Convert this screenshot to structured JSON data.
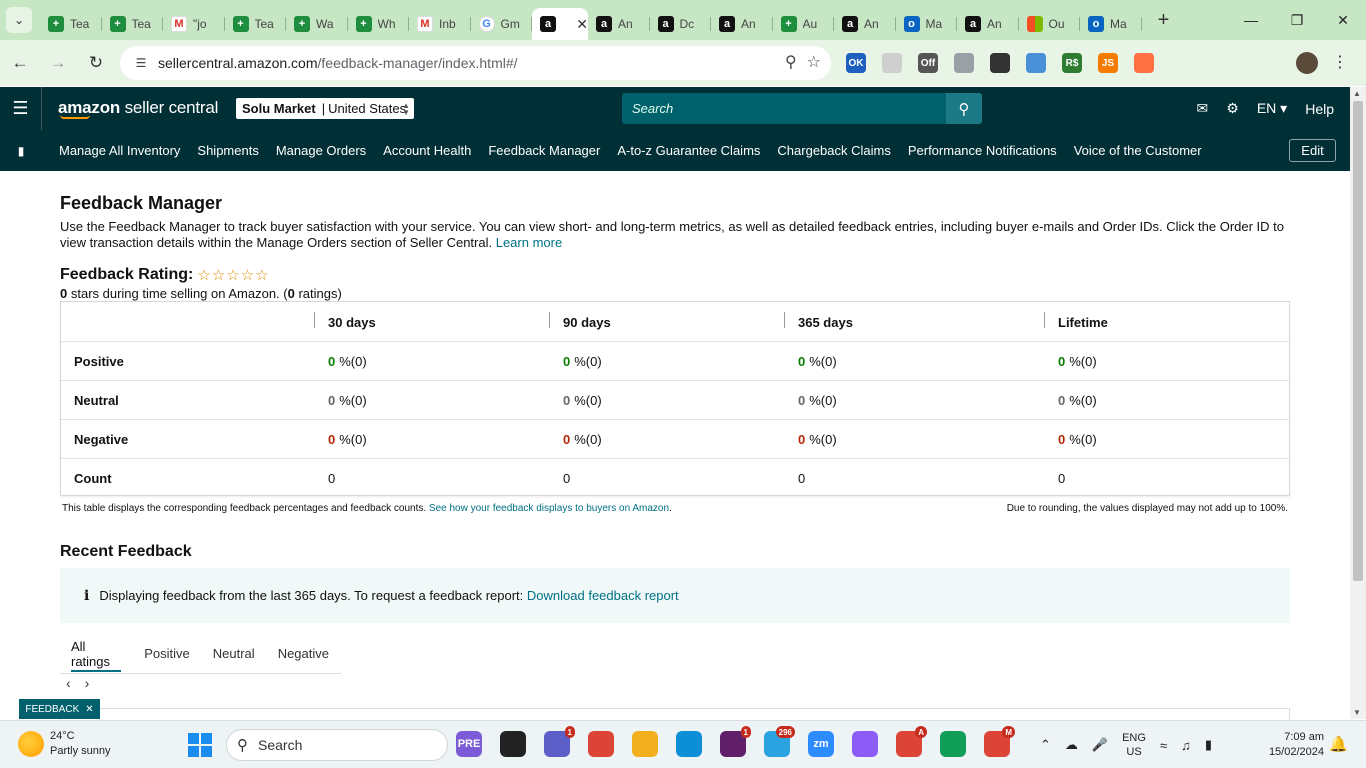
{
  "browser": {
    "tabs": [
      {
        "label": "Tea",
        "favicon": "sheets"
      },
      {
        "label": "Tea",
        "favicon": "sheets"
      },
      {
        "label": "\"jo",
        "favicon": "gmail"
      },
      {
        "label": "Tea",
        "favicon": "sheets"
      },
      {
        "label": "Wa",
        "favicon": "sheets"
      },
      {
        "label": "Wh",
        "favicon": "sheets"
      },
      {
        "label": "Inb",
        "favicon": "gmail"
      },
      {
        "label": "Gm",
        "favicon": "google"
      },
      {
        "label": "",
        "favicon": "amazon",
        "active": true
      },
      {
        "label": "An",
        "favicon": "amazon"
      },
      {
        "label": "Dc",
        "favicon": "amazon"
      },
      {
        "label": "An",
        "favicon": "amazon"
      },
      {
        "label": "Au",
        "favicon": "sheets"
      },
      {
        "label": "An",
        "favicon": "amazon"
      },
      {
        "label": "Ma",
        "favicon": "outlook"
      },
      {
        "label": "An",
        "favicon": "amazon"
      },
      {
        "label": "Ou",
        "favicon": "ms"
      },
      {
        "label": "Ma",
        "favicon": "outlook"
      }
    ],
    "url_host": "sellercentral.amazon.com",
    "url_path": "/feedback-manager/index.html#/",
    "extensions": [
      {
        "label": "OK",
        "color": "#1f5fbf"
      },
      {
        "label": "",
        "color": "#cfcfcf"
      },
      {
        "label": "Off",
        "color": "#555555"
      },
      {
        "label": "",
        "color": "#9aa0a6"
      },
      {
        "label": "",
        "color": "#333333"
      },
      {
        "label": "",
        "color": "#4a90d9"
      },
      {
        "label": "R$",
        "color": "#2e7d32"
      },
      {
        "label": "JS",
        "color": "#f57c00"
      },
      {
        "label": "",
        "color": "#ff7043"
      }
    ]
  },
  "header": {
    "brand_amazon": "amazon",
    "brand_rest": "seller central",
    "store_name": "Solu Market",
    "store_region": "United States",
    "search_placeholder": "Search",
    "language": "EN",
    "help": "Help"
  },
  "nav": {
    "items": [
      "Manage All Inventory",
      "Shipments",
      "Manage Orders",
      "Account Health",
      "Feedback Manager",
      "A-to-z Guarantee Claims",
      "Chargeback Claims",
      "Performance Notifications",
      "Voice of the Customer"
    ],
    "edit": "Edit"
  },
  "page": {
    "title": "Feedback Manager",
    "intro": "Use the Feedback Manager to track buyer satisfaction with your service. You can view short- and long-term metrics, as well as detailed feedback entries, including buyer e-mails and Order IDs. Click the Order ID to view transaction details within the Manage Orders section of Seller Central. ",
    "learn_more": "Learn more",
    "rating_label": "Feedback Rating:",
    "stars_display": "☆☆☆☆☆",
    "stars_count": "0",
    "stars_text_mid": " stars during time selling on Amazon. (",
    "ratings_count": "0",
    "stars_text_end": " ratings)"
  },
  "table": {
    "columns": [
      "30 days",
      "90 days",
      "365 days",
      "Lifetime"
    ],
    "rows": [
      {
        "label": "Positive",
        "type": "pos",
        "cells": [
          {
            "n": "0",
            "r": "%(0)"
          },
          {
            "n": "0",
            "r": "%(0)"
          },
          {
            "n": "0",
            "r": "%(0)"
          },
          {
            "n": "0",
            "r": "%(0)"
          }
        ]
      },
      {
        "label": "Neutral",
        "type": "neu",
        "cells": [
          {
            "n": "0",
            "r": "%(0)"
          },
          {
            "n": "0",
            "r": "%(0)"
          },
          {
            "n": "0",
            "r": "%(0)"
          },
          {
            "n": "0",
            "r": "%(0)"
          }
        ]
      },
      {
        "label": "Negative",
        "type": "neg",
        "cells": [
          {
            "n": "0",
            "r": "%(0)"
          },
          {
            "n": "0",
            "r": "%(0)"
          },
          {
            "n": "0",
            "r": "%(0)"
          },
          {
            "n": "0",
            "r": "%(0)"
          }
        ]
      }
    ],
    "count_label": "Count",
    "counts": [
      "0",
      "0",
      "0",
      "0"
    ],
    "footnote": "This table displays the corresponding feedback percentages and feedback counts. ",
    "footnote_link": "See how your feedback displays to buyers on Amazon",
    "footnote_end": ".",
    "rounding_note": "Due to rounding, the values displayed may not add up to 100%."
  },
  "recent": {
    "title": "Recent Feedback",
    "info_icon": "i",
    "info_text": "Displaying feedback from the last 365 days. To request a feedback report: ",
    "download_link": "Download feedback report",
    "tabs": [
      "All ratings",
      "Positive",
      "Neutral",
      "Negative"
    ],
    "feedback_pill": "FEEDBACK"
  },
  "taskbar": {
    "temp": "24°C",
    "condition": "Partly sunny",
    "search": "Search",
    "apps": [
      {
        "name": "copilot",
        "color": "#7b5cd6",
        "label": "PRE",
        "badge": ""
      },
      {
        "name": "terminal",
        "color": "#222222",
        "label": "",
        "badge": ""
      },
      {
        "name": "teams-chat",
        "color": "#5b5fc7",
        "label": "",
        "badge": "1"
      },
      {
        "name": "chrome",
        "color": "#db4437",
        "label": "",
        "badge": ""
      },
      {
        "name": "file-explorer",
        "color": "#f2b01e",
        "label": "",
        "badge": ""
      },
      {
        "name": "edge",
        "color": "#0c8fd6",
        "label": "",
        "badge": ""
      },
      {
        "name": "slack",
        "color": "#611f69",
        "label": "",
        "badge": "1"
      },
      {
        "name": "telegram",
        "color": "#2aa3e0",
        "label": "",
        "badge": "296"
      },
      {
        "name": "zoom",
        "color": "#2d8cff",
        "label": "zm",
        "badge": ""
      },
      {
        "name": "messenger",
        "color": "#8b5cf6",
        "label": "",
        "badge": ""
      },
      {
        "name": "chrome-profile-a",
        "color": "#db4437",
        "label": "",
        "badge": "A"
      },
      {
        "name": "chrome-profile-photo",
        "color": "#0f9d58",
        "label": "",
        "badge": ""
      },
      {
        "name": "chrome-profile-m",
        "color": "#db4437",
        "label": "",
        "badge": "M"
      }
    ],
    "lang_top": "ENG",
    "lang_bottom": "US",
    "time": "7:09 am",
    "date": "15/02/2024"
  }
}
